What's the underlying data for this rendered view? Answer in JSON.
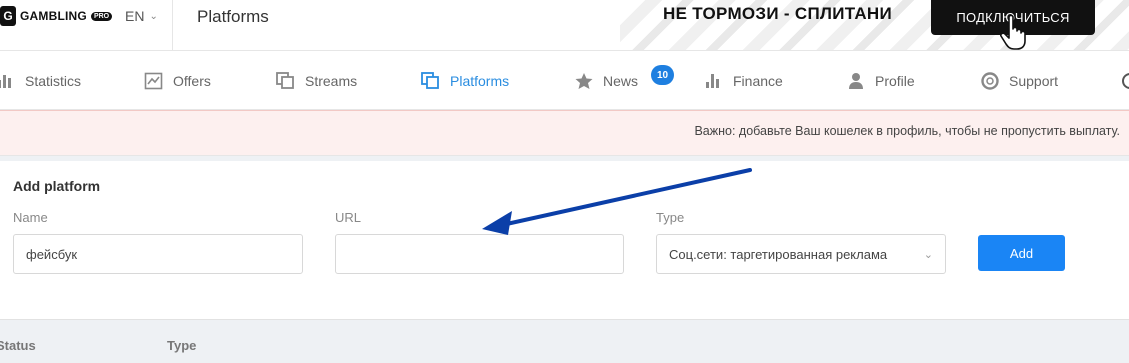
{
  "header": {
    "logo_text": "GAMBLING",
    "logo_badge": "PRO",
    "language": "EN",
    "page_title": "Platforms"
  },
  "banner": {
    "text": "НЕ ТОРМОЗИ - СПЛИТАНИ",
    "button_label": "ПОДКЛЮЧИТЬСЯ"
  },
  "nav": {
    "items": [
      {
        "label": "Statistics",
        "icon": "bar-chart-icon"
      },
      {
        "label": "Offers",
        "icon": "chart-line-icon"
      },
      {
        "label": "Streams",
        "icon": "copy-icon"
      },
      {
        "label": "Platforms",
        "icon": "copy-icon",
        "active": true
      },
      {
        "label": "News",
        "icon": "star-icon",
        "badge": "10"
      },
      {
        "label": "Finance",
        "icon": "bar-chart-icon"
      },
      {
        "label": "Profile",
        "icon": "user-icon"
      },
      {
        "label": "Support",
        "icon": "lifebuoy-icon"
      }
    ]
  },
  "notice": {
    "text": "Важно: добавьте Ваш кошелек в профиль, чтобы не пропустить выплату."
  },
  "form": {
    "title": "Add platform",
    "name_label": "Name",
    "name_value": "фейсбук",
    "url_label": "URL",
    "url_value": "",
    "type_label": "Type",
    "type_value": "Соц.сети: таргетированная реклама",
    "add_label": "Add"
  },
  "table": {
    "columns": [
      "Status",
      "Type"
    ]
  },
  "colors": {
    "accent": "#1a85f5",
    "active_nav": "#2a8de0",
    "notice_bg": "#fdf0ef",
    "annotation_arrow": "#0b3fa8"
  }
}
